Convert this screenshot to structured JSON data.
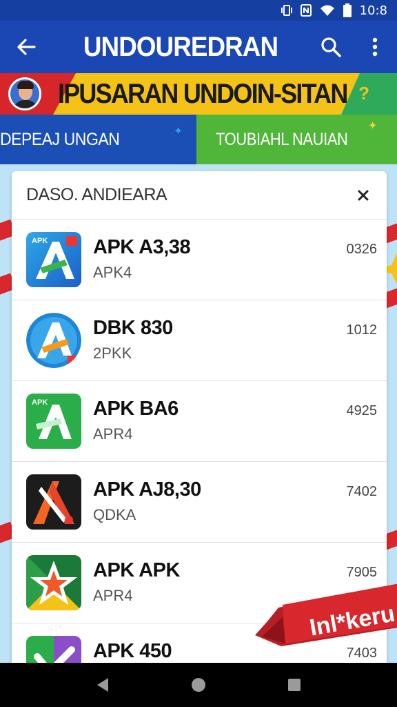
{
  "status_bar": {
    "time": "10:8"
  },
  "app_bar": {
    "title": "UNDOUREDRAN",
    "back_icon": "arrow-back-icon",
    "search_icon": "search-icon",
    "more_icon": "more-vert-icon"
  },
  "banner": {
    "text": "IPUSARAN UNDOIN-SITAN",
    "badge": "?"
  },
  "tabs": [
    {
      "label": "DEPEAJ UNGAN"
    },
    {
      "label": "TOUBIAHL NAUIAN"
    }
  ],
  "card": {
    "title": "DASO. ANDIEARA",
    "close_icon": "close-icon",
    "items": [
      {
        "name": "APK A3,38",
        "sub": "APK4",
        "value": "0326",
        "icon": "apk-blue-a-icon",
        "icon_badge": "APK"
      },
      {
        "name": "DBK 830",
        "sub": "2PKK",
        "value": "1012",
        "icon": "apk-circle-a-icon",
        "icon_badge": ""
      },
      {
        "name": "APK BA6",
        "sub": "APR4",
        "value": "4925",
        "icon": "apk-green-a-icon",
        "icon_badge": "APK"
      },
      {
        "name": "APK AJ8,30",
        "sub": "QDKA",
        "value": "7402",
        "icon": "apk-orange-a-icon",
        "icon_badge": ""
      },
      {
        "name": "APK APK",
        "sub": "APR4",
        "value": "7905",
        "icon": "apk-star-icon",
        "icon_badge": ""
      },
      {
        "name": "APK 450",
        "sub": "",
        "value": "7403",
        "icon": "apk-check-icon",
        "icon_badge": ""
      }
    ]
  },
  "install_ribbon": {
    "label": "Inl*keru"
  },
  "colors": {
    "status_bar": "#163fa2",
    "app_bar": "#1a47b3",
    "banner": "#f5c318",
    "tab_blue": "#1c4fb6",
    "tab_green": "#4fb63a",
    "ribbon_red": "#d8282d"
  }
}
